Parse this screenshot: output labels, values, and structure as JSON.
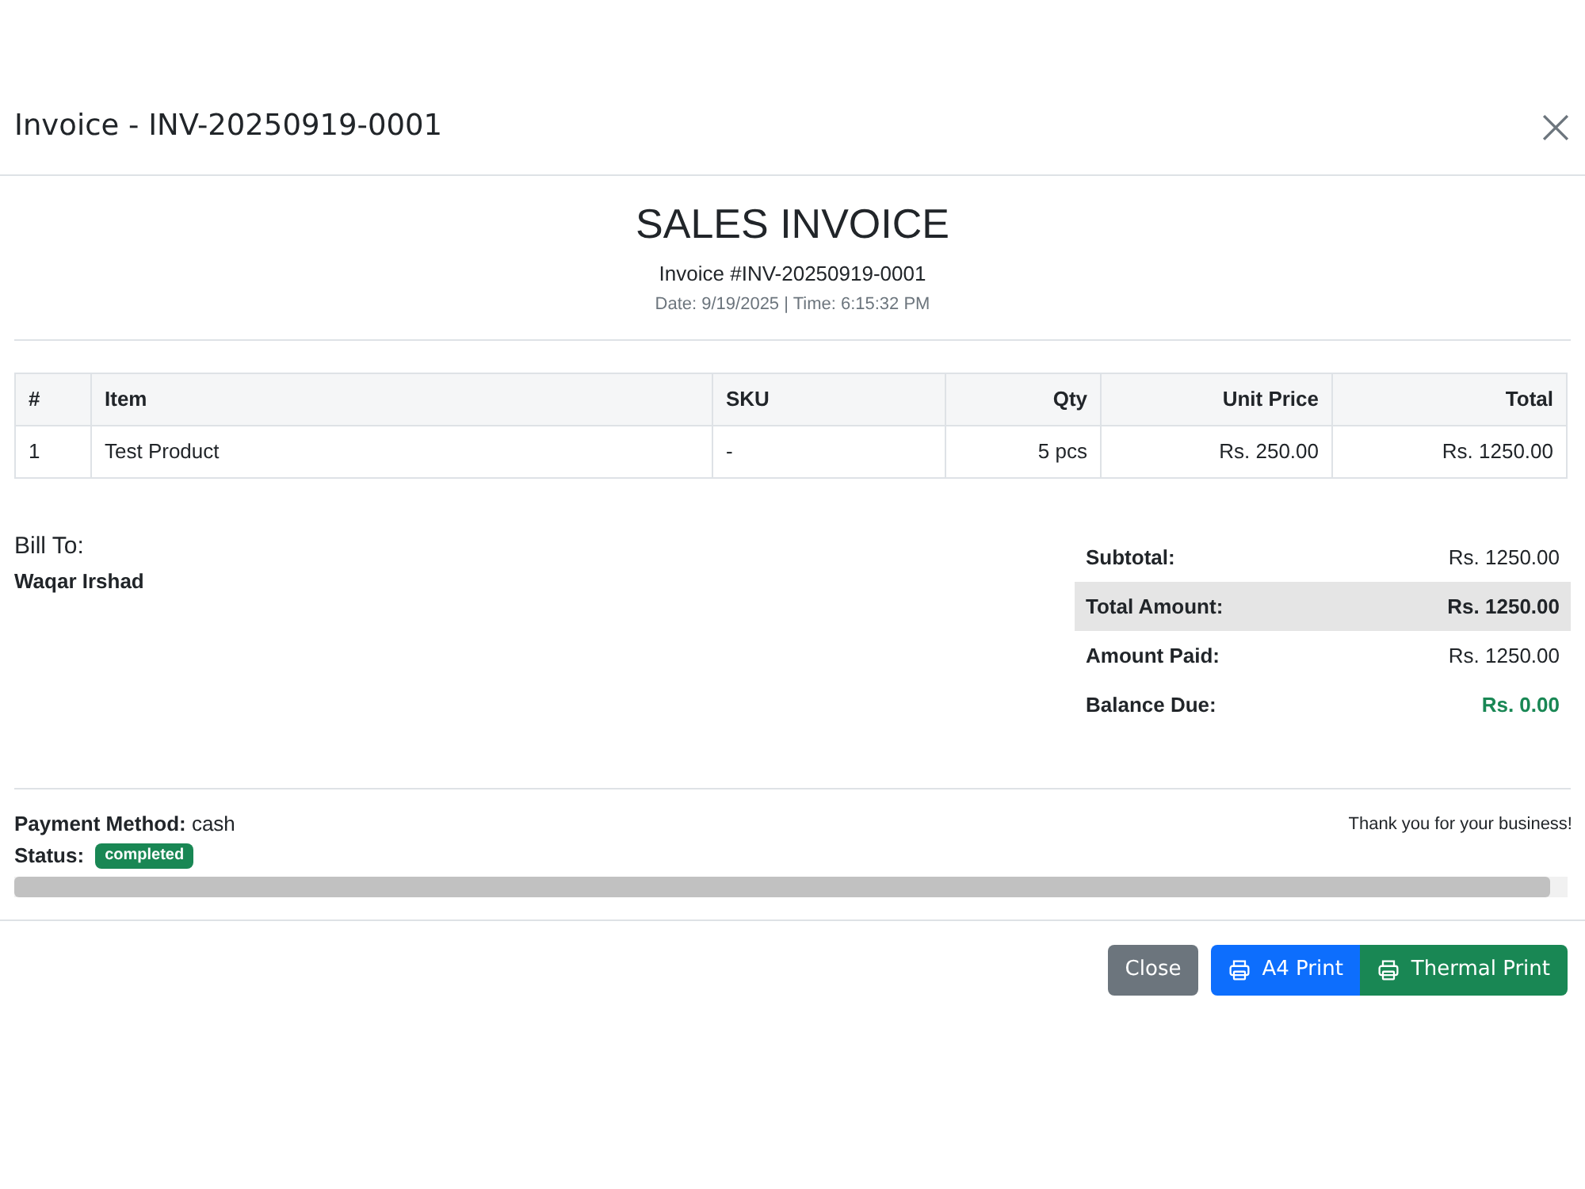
{
  "modal": {
    "title": "Invoice - INV-20250919-0001"
  },
  "invoice": {
    "heading": "SALES INVOICE",
    "number": "Invoice #INV-20250919-0001",
    "datetime": "Date: 9/19/2025 | Time: 6:15:32 PM"
  },
  "table": {
    "columns": [
      {
        "label": "#",
        "kind": "text"
      },
      {
        "label": "Item",
        "kind": "text"
      },
      {
        "label": "SKU",
        "kind": "text"
      },
      {
        "label": "Qty",
        "kind": "numeric"
      },
      {
        "label": "Unit Price",
        "kind": "numeric"
      },
      {
        "label": "Total",
        "kind": "numeric"
      }
    ],
    "rows": [
      [
        "1",
        "Test Product",
        "-",
        "5 pcs",
        "Rs. 250.00",
        "Rs. 1250.00"
      ]
    ]
  },
  "bill_to": {
    "label": "Bill To:",
    "name": "Waqar Irshad"
  },
  "totals": [
    {
      "label": "Subtotal:",
      "value": "Rs. 1250.00",
      "kind": "plain"
    },
    {
      "label": "Total Amount:",
      "value": "Rs. 1250.00",
      "kind": "highlight"
    },
    {
      "label": "Amount Paid:",
      "value": "Rs. 1250.00",
      "kind": "plain"
    },
    {
      "label": "Balance Due:",
      "value": "Rs. 0.00",
      "kind": "balance"
    }
  ],
  "payment": {
    "label": "Payment Method:",
    "value": "cash"
  },
  "status": {
    "label": "Status:",
    "value": "completed"
  },
  "thank_you": "Thank you for your business!",
  "buttons": [
    {
      "label": "Close",
      "kind": "secondary"
    },
    {
      "label": "A4 Print",
      "kind": "primary"
    },
    {
      "label": "Thermal Print",
      "kind": "success"
    }
  ]
}
